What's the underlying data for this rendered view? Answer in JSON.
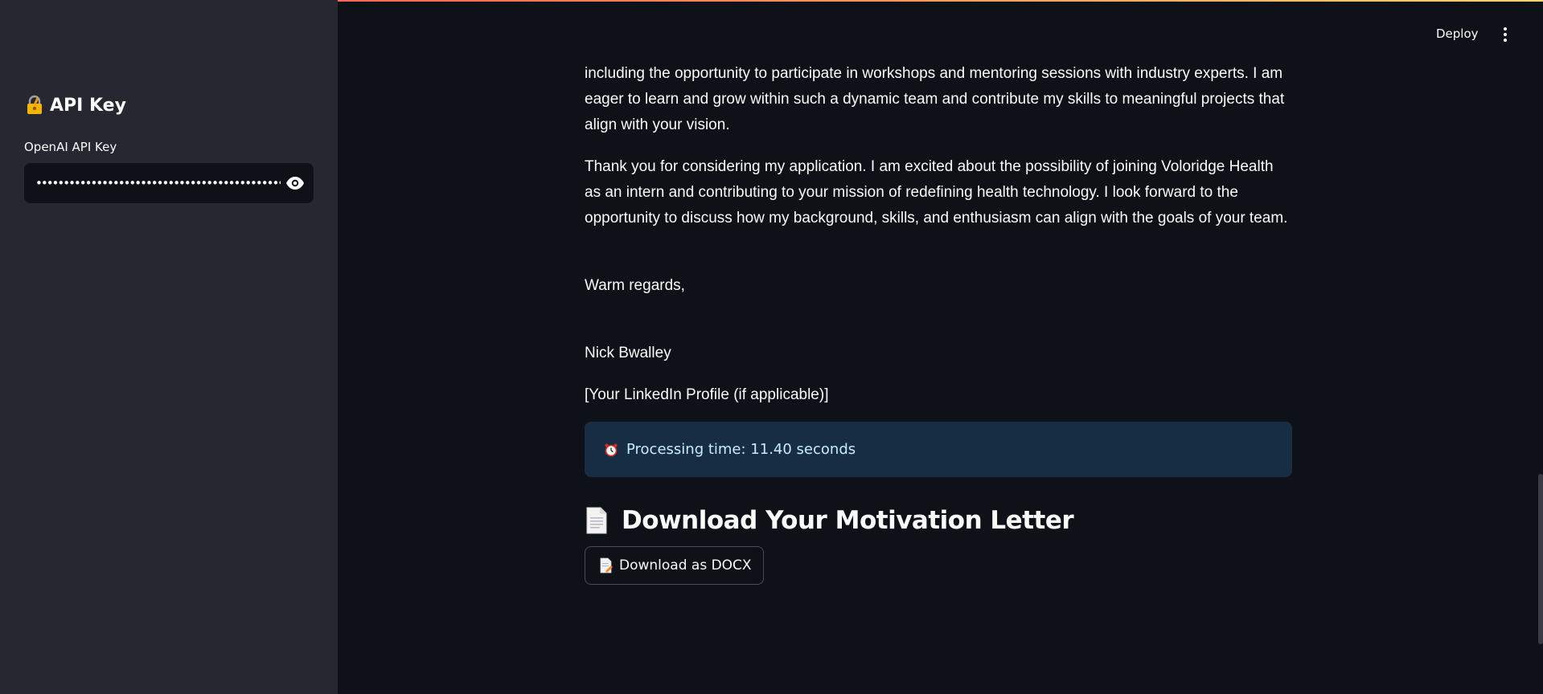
{
  "sidebar": {
    "title": "API Key",
    "title_icon": "lock-with-key-icon",
    "field_label": "OpenAI API Key",
    "field_value": "••••••••••••••••••••••••••••••••••••••••••••••••••••",
    "reveal_icon": "eye-icon"
  },
  "header": {
    "deploy_label": "Deploy",
    "menu_icon": "vertical-ellipsis-icon"
  },
  "letter": {
    "paragraph_1": "including the opportunity to participate in workshops and mentoring sessions with industry experts. I am eager to learn and grow within such a dynamic team and contribute my skills to meaningful projects that align with your vision.",
    "paragraph_2": "Thank you for considering my application. I am excited about the possibility of joining Voloridge Health as an intern and contributing to your mission of redefining health technology. I look forward to the opportunity to discuss how my background, skills, and enthusiasm can align with the goals of your team.",
    "closing": "Warm regards,",
    "signature": "Nick Bwalley",
    "linkedin": "[Your LinkedIn Profile (if applicable)]"
  },
  "processing": {
    "icon": "alarm-clock-icon",
    "text": "Processing time: 11.40 seconds"
  },
  "download": {
    "heading": "Download Your Motivation Letter",
    "heading_icon": "document-icon",
    "button_label": "Download as DOCX",
    "button_icon": "document-pencil-icon"
  },
  "colors": {
    "background": "#0e1117",
    "sidebar": "#262730",
    "info_box": "#172d43",
    "info_text": "#c7ebff"
  }
}
